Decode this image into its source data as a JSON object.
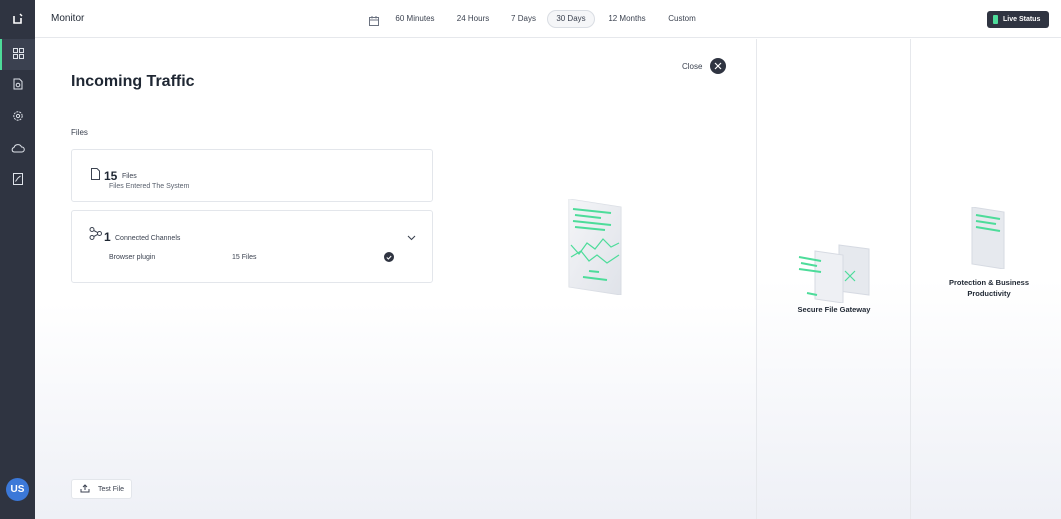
{
  "app": {
    "title": "Monitor"
  },
  "user": {
    "initials": "US"
  },
  "sidebar": {
    "items": [
      {
        "name": "dashboard",
        "icon": "grid-icon"
      },
      {
        "name": "files",
        "icon": "file-check-icon"
      },
      {
        "name": "settings",
        "icon": "gear-icon"
      },
      {
        "name": "cloud",
        "icon": "cloud-icon"
      },
      {
        "name": "reports",
        "icon": "report-icon"
      }
    ]
  },
  "time_range": {
    "options": [
      "60 Minutes",
      "24 Hours",
      "7 Days",
      "30 Days",
      "12 Months",
      "Custom"
    ],
    "selected": "30 Days"
  },
  "live_status": {
    "label": "Live Status"
  },
  "panel": {
    "title": "Incoming Traffic",
    "close_label": "Close",
    "section_label": "Files",
    "files_card": {
      "count": "15",
      "unit": "Files",
      "description": "Files Entered The System"
    },
    "channels_card": {
      "count": "1",
      "unit": "Connected Channels",
      "rows": [
        {
          "name": "Browser plugin",
          "files": "15 Files"
        }
      ]
    },
    "test_file_label": "Test File"
  },
  "stages": {
    "gateway_label": "Secure File Gateway",
    "protection_label": "Protection & Business Productivity"
  },
  "colors": {
    "accent": "#4ddc9a",
    "sidebar": "#2f3441",
    "avatar": "#3b78d8"
  }
}
